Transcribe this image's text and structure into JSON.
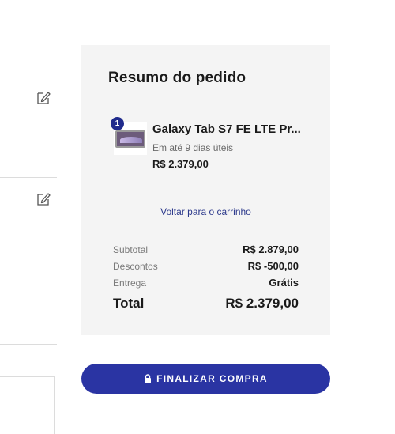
{
  "order_summary": {
    "title": "Resumo do pedido",
    "item": {
      "quantity": "1",
      "name": "Galaxy Tab S7 FE LTE Pr...",
      "delivery": "Em até 9 dias úteis",
      "price": "R$ 2.379,00"
    },
    "back_to_cart_label": "Voltar para o carrinho",
    "subtotal": {
      "label": "Subtotal",
      "value": "R$ 2.879,00"
    },
    "discounts": {
      "label": "Descontos",
      "value": "R$ -500,00"
    },
    "shipping": {
      "label": "Entrega",
      "value": "Grátis"
    },
    "total": {
      "label": "Total",
      "value": "R$ 2.379,00"
    }
  },
  "checkout": {
    "button_label": "FINALIZAR COMPRA",
    "icon": "lock-icon"
  },
  "left_panel": {
    "icons": [
      "edit-icon",
      "edit-icon"
    ]
  },
  "colors": {
    "accent": "#2a34a3",
    "badge": "#1f2a8c",
    "link": "#2d3a8c",
    "panel_bg": "#f4f4f4"
  }
}
